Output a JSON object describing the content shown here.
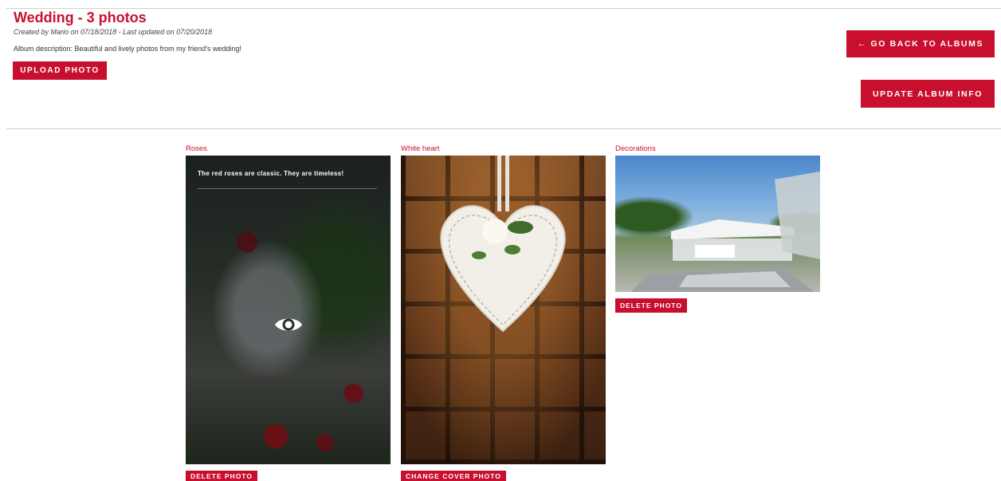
{
  "album": {
    "title": "Wedding - 3 photos",
    "meta": "Created by Mario on 07/18/2018 - Last updated on 07/20/2018",
    "description": "Album description: Beautiful and lively photos from my friend's wedding!"
  },
  "actions": {
    "upload_label": "UPLOAD PHOTO",
    "back_label": "← GO BACK TO ALBUMS",
    "update_label": "UPDATE ALBUM INFO"
  },
  "photos": [
    {
      "title": "Roses",
      "caption": "The red roses are classic. They are timeless!",
      "hover_icon": "eye-icon",
      "buttons": [
        "DELETE PHOTO"
      ]
    },
    {
      "title": "White heart",
      "buttons": [
        "CHANGE COVER PHOTO"
      ]
    },
    {
      "title": "Decorations",
      "buttons": [
        "DELETE PHOTO"
      ]
    }
  ],
  "colors": {
    "accent": "#c8102e",
    "divider": "#cfcfcf"
  }
}
